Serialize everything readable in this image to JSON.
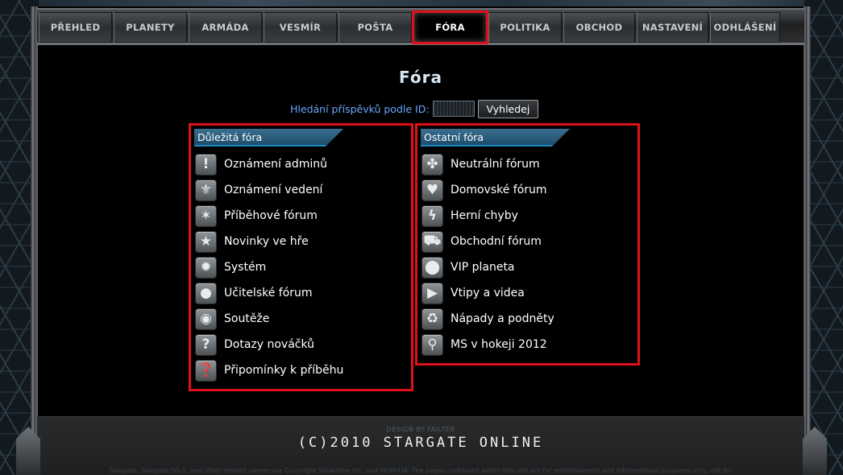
{
  "nav": [
    {
      "label": "PŘEHLED",
      "w": 91
    },
    {
      "label": "PLANETY",
      "w": 91
    },
    {
      "label": "ARMÁDA",
      "w": 91
    },
    {
      "label": "VESMÍR",
      "w": 91
    },
    {
      "label": "POŠTA",
      "w": 91
    },
    {
      "label": "FÓRA",
      "w": 91,
      "active": true
    },
    {
      "label": "POLITIKA",
      "w": 91
    },
    {
      "label": "OBCHOD",
      "w": 89
    },
    {
      "label": "NASTAVENÍ",
      "w": 89
    },
    {
      "label": "ODHLÁŠENÍ",
      "w": 87
    }
  ],
  "page": {
    "title": "Fóra"
  },
  "search": {
    "label": "Hledání příspěvků podle ID:",
    "value": "",
    "button_label": "Vyhledej"
  },
  "important_forums": {
    "header": "Důležitá fóra",
    "items": [
      {
        "label": "Oznámení adminů",
        "icon": "!"
      },
      {
        "label": "Oznámení vedení",
        "icon": "⚜"
      },
      {
        "label": "Příběhové fórum",
        "icon": "✶"
      },
      {
        "label": "Novinky ve hře",
        "icon": "★"
      },
      {
        "label": "Systém",
        "icon": "✹"
      },
      {
        "label": "Učitelské fórum",
        "icon": "●"
      },
      {
        "label": "Soutěže",
        "icon": "◉"
      },
      {
        "label": "Dotazy nováčků",
        "icon": "?"
      },
      {
        "label": "Připomínky k příběhu",
        "icon": "❓"
      }
    ]
  },
  "other_forums": {
    "header": "Ostatní fóra",
    "items": [
      {
        "label": "Neutrální fórum",
        "icon": "✤"
      },
      {
        "label": "Domovské fórum",
        "icon": "♥"
      },
      {
        "label": "Herní chyby",
        "icon": "ϟ"
      },
      {
        "label": "Obchodní fórum",
        "icon": "⛟"
      },
      {
        "label": "VIP planeta",
        "icon": "⬤"
      },
      {
        "label": "Vtipy a videa",
        "icon": "▶"
      },
      {
        "label": "Nápady a podněty",
        "icon": "♻"
      },
      {
        "label": "MS v hokeji 2012",
        "icon": "⚲"
      }
    ]
  },
  "footer": {
    "design_by": "DESIGN BY FAILTER",
    "copyright": "(C)2010 STARGATE ONLINE",
    "legal": "Stargate, Stargate SG-1, and other related names are Copyright Showtime Inc. and MGM/UA. The pages contained within this site are for entertainment and informational purposes only, not for"
  }
}
